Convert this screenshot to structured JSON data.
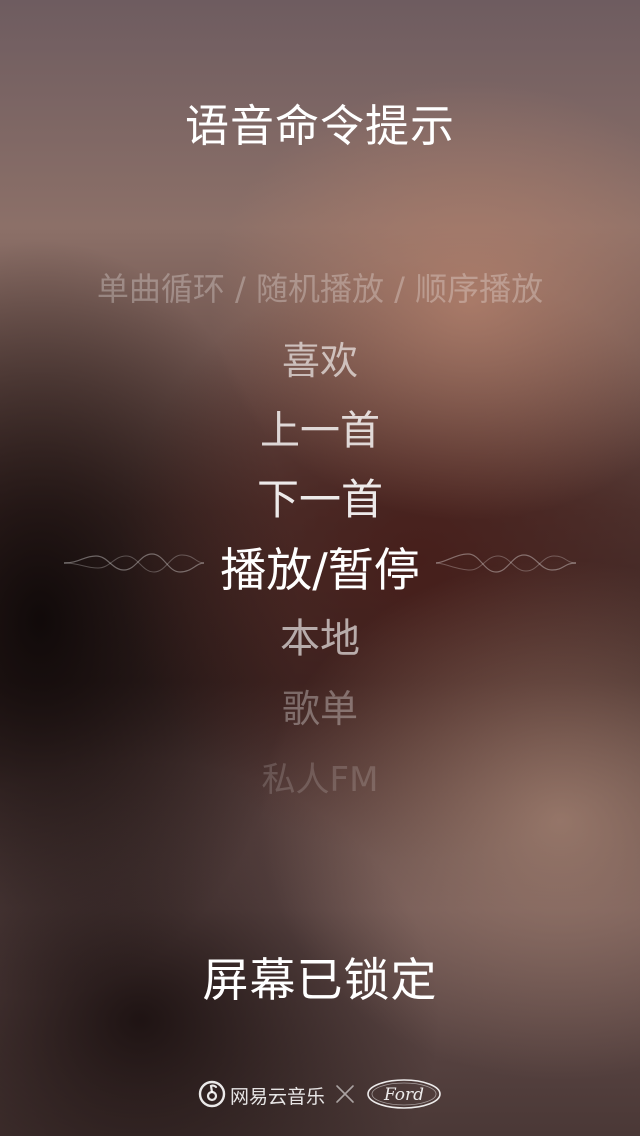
{
  "title": "语音命令提示",
  "commands": [
    "单曲循环 / 随机播放 / 顺序播放",
    "喜欢",
    "上一首",
    "下一首",
    "播放/暂停",
    "本地",
    "歌单",
    "私人FM"
  ],
  "status": "屏幕已锁定",
  "footer": {
    "app_name": "网易云音乐",
    "partner_logo_text": "Ford"
  }
}
